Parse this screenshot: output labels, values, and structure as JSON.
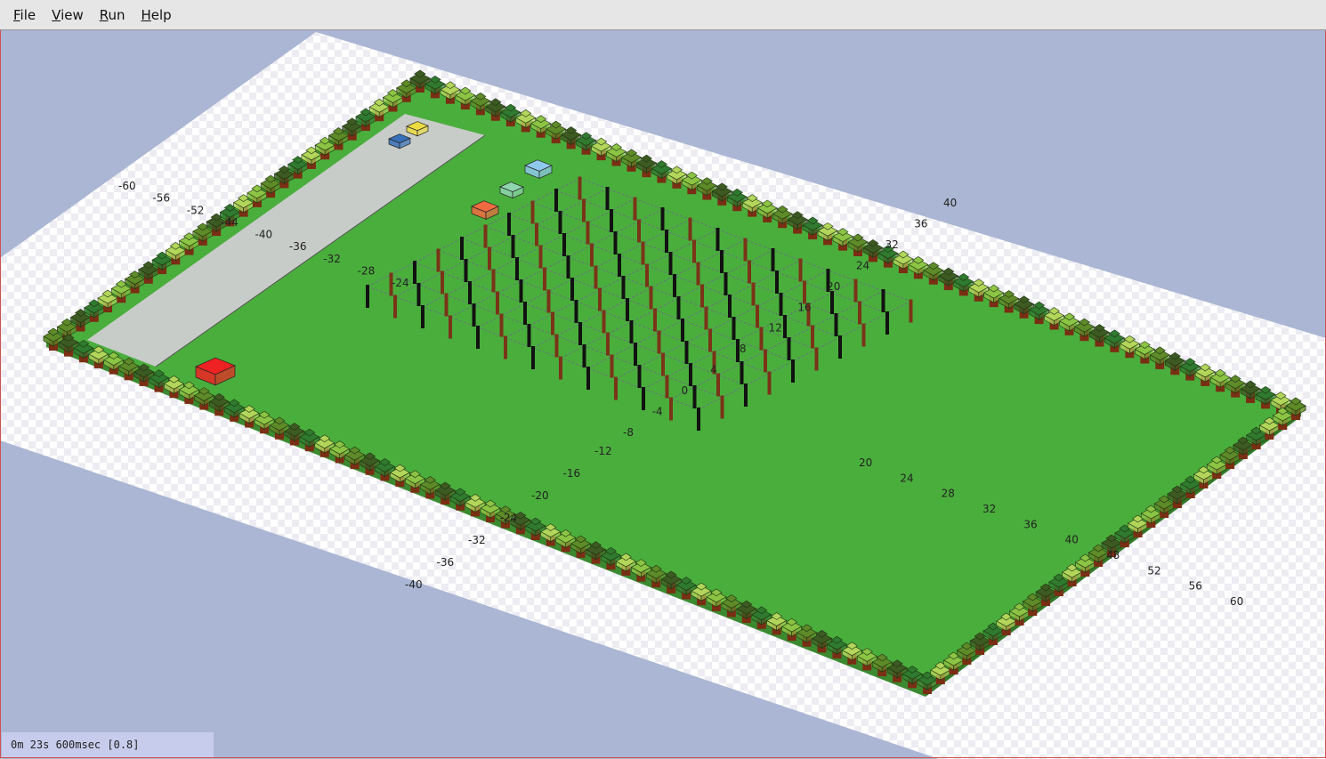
{
  "menu": {
    "file": "File",
    "view": "View",
    "run": "Run",
    "help": "Help"
  },
  "status": {
    "time": "0m 23s 600msec [0.8]"
  },
  "colors": {
    "background": "#aab6d3",
    "floor_checker": "#e9e9ef",
    "ground": "#4aae3c",
    "path": "#c8ccc8",
    "trunk": "#7a2e14",
    "foliage": [
      "#8cc444",
      "#5e8a28",
      "#3d5a22",
      "#2f7a2f",
      "#b3d65a"
    ],
    "robot_red": "#ee2222",
    "robot_orange": "#f06a40",
    "robot_lightblue": "#8ec8ec",
    "robot_mint": "#8ed6b0",
    "robot_blue": "#3670b8",
    "robot_yellow": "#ecdc40"
  },
  "axis_labels": {
    "upper_left": [
      "-60",
      "-56",
      "-52",
      "-44",
      "-40",
      "-36",
      "-32",
      "-28",
      "-24"
    ],
    "upper_right": [
      "40",
      "36",
      "32",
      "24",
      "20",
      "16",
      "12",
      "8",
      "4",
      "0",
      "-4",
      "-8"
    ],
    "lower_left": [
      "-12",
      "-16",
      "-20",
      "-24",
      "-32",
      "-36",
      "-40"
    ],
    "lower_right": [
      "20",
      "24",
      "28",
      "32",
      "36",
      "40",
      "48",
      "52",
      "56",
      "60"
    ]
  }
}
